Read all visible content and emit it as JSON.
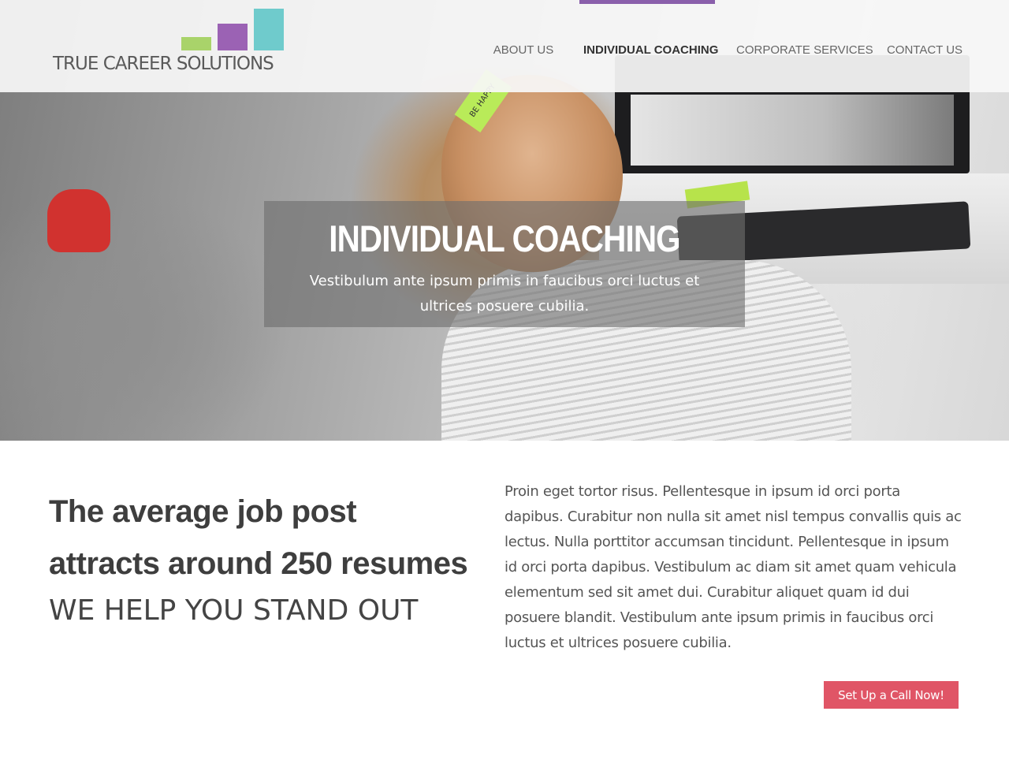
{
  "brand": {
    "name": "TRUE CAREER SOLUTIONS",
    "logo_colors": [
      "#a9d36a",
      "#9b62b4",
      "#6fcbcc"
    ]
  },
  "nav": {
    "items": [
      {
        "label": "About Us"
      },
      {
        "label": "Individual Coaching"
      },
      {
        "label": "Corporate Services"
      },
      {
        "label": "Contact Us"
      }
    ],
    "active_label": "Individual Coaching",
    "active_color": "#8a5fab"
  },
  "hero": {
    "title": "INDIVIDUAL COACHING",
    "subtitle": "Vestibulum ante ipsum primis in faucibus orci luctus et ultrices posuere cubilia.",
    "photo_note": "BE HAPPY"
  },
  "content": {
    "headline": "The average job post attracts around 250 resumes",
    "tagline": "WE HELP YOU STAND OUT",
    "body": "Proin eget tortor risus. Pellentesque in ipsum id orci porta dapibus. Curabitur non nulla sit amet nisl tempus convallis quis ac lectus. Nulla porttitor accumsan tincidunt. Pellentesque in ipsum id orci porta dapibus. Vestibulum ac diam sit amet quam vehicula elementum sed sit amet dui. Curabitur aliquet quam id dui posuere blandit. Vestibulum ante ipsum primis in faucibus orci luctus et ultrices posuere cubilia.",
    "cta_label": "Set Up a Call Now!",
    "cta_color": "#e05566"
  }
}
